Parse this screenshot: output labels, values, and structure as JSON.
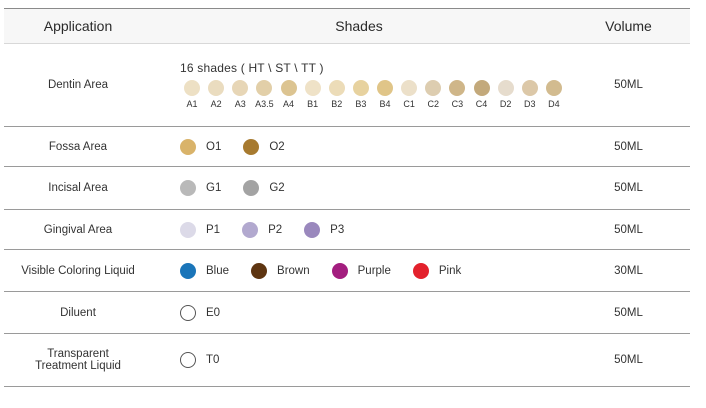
{
  "header": {
    "application": "Application",
    "shades": "Shades",
    "volume": "Volume"
  },
  "rows": [
    {
      "application": "Dentin Area",
      "intro": "16 shades ( HT \\ ST \\ TT )",
      "shades": [
        {
          "label": "A1",
          "color": "#ede0c4"
        },
        {
          "label": "A2",
          "color": "#eadcbf"
        },
        {
          "label": "A3",
          "color": "#e7d6b6"
        },
        {
          "label": "A3.5",
          "color": "#e2cfa8"
        },
        {
          "label": "A4",
          "color": "#dcc491"
        },
        {
          "label": "B1",
          "color": "#efe2c7"
        },
        {
          "label": "B2",
          "color": "#ecdcb8"
        },
        {
          "label": "B3",
          "color": "#e7d29f"
        },
        {
          "label": "B4",
          "color": "#e0c588"
        },
        {
          "label": "C1",
          "color": "#ece0c9"
        },
        {
          "label": "C2",
          "color": "#ddcdb0"
        },
        {
          "label": "C3",
          "color": "#cfb689"
        },
        {
          "label": "C4",
          "color": "#c3a97b"
        },
        {
          "label": "D2",
          "color": "#e6dccd"
        },
        {
          "label": "D3",
          "color": "#dcc8a8"
        },
        {
          "label": "D4",
          "color": "#d2bb8f"
        }
      ],
      "volume": "50ML"
    },
    {
      "application": "Fossa Area",
      "shades": [
        {
          "label": "O1",
          "color": "#d9b36a"
        },
        {
          "label": "O2",
          "color": "#a77a2f"
        }
      ],
      "volume": "50ML"
    },
    {
      "application": "Incisal Area",
      "shades": [
        {
          "label": "G1",
          "color": "#b9b9b9"
        },
        {
          "label": "G2",
          "color": "#a3a3a3"
        }
      ],
      "volume": "50ML"
    },
    {
      "application": "Gingival Area",
      "shades": [
        {
          "label": "P1",
          "color": "#dcdae8"
        },
        {
          "label": "P2",
          "color": "#b2a9cf"
        },
        {
          "label": "P3",
          "color": "#9a88bd"
        }
      ],
      "volume": "50ML"
    },
    {
      "application": "Visible Coloring Liquid",
      "shades": [
        {
          "label": "Blue",
          "color": "#1a75b9"
        },
        {
          "label": "Brown",
          "color": "#5e3511"
        },
        {
          "label": "Purple",
          "color": "#a31e7f"
        },
        {
          "label": "Pink",
          "color": "#e3212c"
        }
      ],
      "volume": "30ML"
    },
    {
      "application": "Diluent",
      "shades": [
        {
          "label": "E0",
          "color": "outline"
        }
      ],
      "volume": "50ML"
    },
    {
      "application_line1": "Transparent",
      "application_line2": "Treatment Liquid",
      "shades": [
        {
          "label": "T0",
          "color": "outline"
        }
      ],
      "volume": "50ML"
    }
  ]
}
